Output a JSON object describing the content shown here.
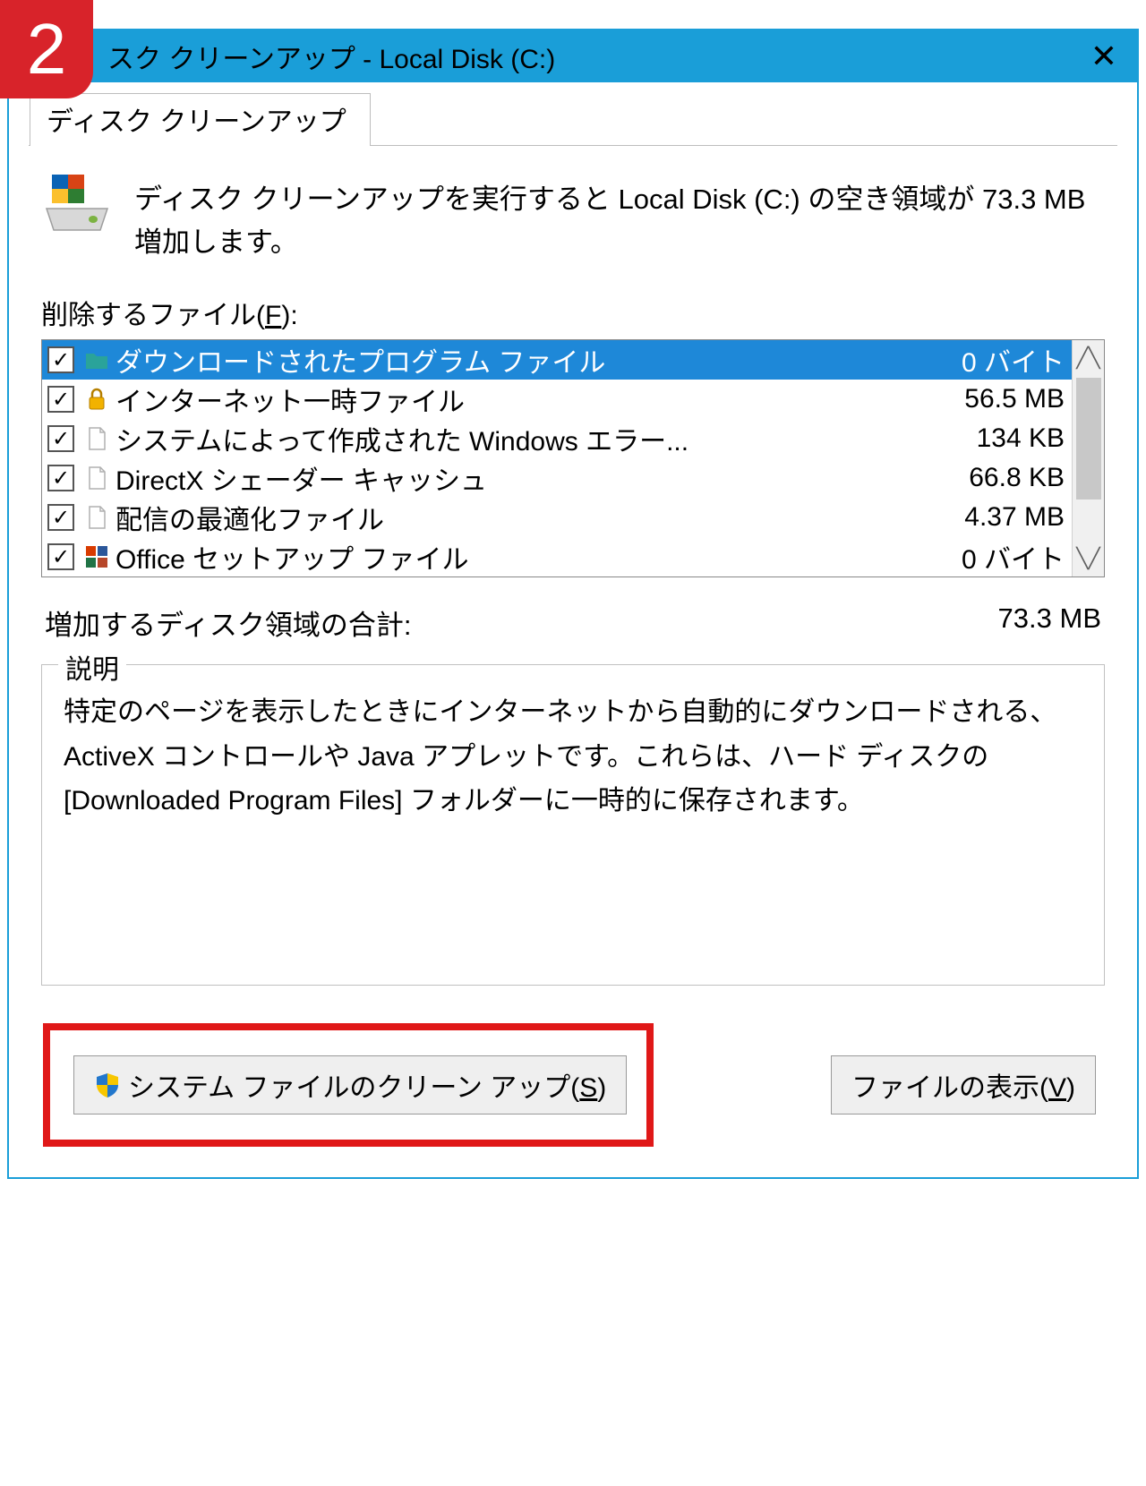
{
  "step_number": "2",
  "titlebar": {
    "title": "スク クリーンアップ - Local Disk (C:)"
  },
  "tab": {
    "label": "ディスク クリーンアップ"
  },
  "summary": {
    "text": "ディスク クリーンアップを実行すると Local Disk (C:) の空き領域が 73.3 MB 増加します。"
  },
  "files_label": {
    "text": "削除するファイル(",
    "hotkey": "F",
    "suffix": "):"
  },
  "file_items": [
    {
      "name": "ダウンロードされたプログラム ファイル",
      "size": "0 バイト",
      "checked": true,
      "selected": true,
      "icon": "folder-teal"
    },
    {
      "name": "インターネット一時ファイル",
      "size": "56.5 MB",
      "checked": true,
      "selected": false,
      "icon": "lock"
    },
    {
      "name": "システムによって作成された Windows エラー...",
      "size": "134 KB",
      "checked": true,
      "selected": false,
      "icon": "file"
    },
    {
      "name": "DirectX シェーダー キャッシュ",
      "size": "66.8 KB",
      "checked": true,
      "selected": false,
      "icon": "file"
    },
    {
      "name": "配信の最適化ファイル",
      "size": "4.37 MB",
      "checked": true,
      "selected": false,
      "icon": "file"
    },
    {
      "name": "Office セットアップ ファイル",
      "size": "0 バイト",
      "checked": true,
      "selected": false,
      "icon": "office"
    }
  ],
  "total": {
    "label": "増加するディスク領域の合計:",
    "value": "73.3 MB"
  },
  "description": {
    "title": "説明",
    "text": "特定のページを表示したときにインターネットから自動的にダウンロードされる、ActiveX コントロールや Java アプレットです。これらは、ハード ディスクの [Downloaded Program Files] フォルダーに一時的に保存されます。"
  },
  "buttons": {
    "cleanup_prefix": "システム ファイルのクリーン アップ(",
    "cleanup_hotkey": "S",
    "cleanup_suffix": ")",
    "view_prefix": "ファイルの表示(",
    "view_hotkey": "V",
    "view_suffix": ")"
  }
}
